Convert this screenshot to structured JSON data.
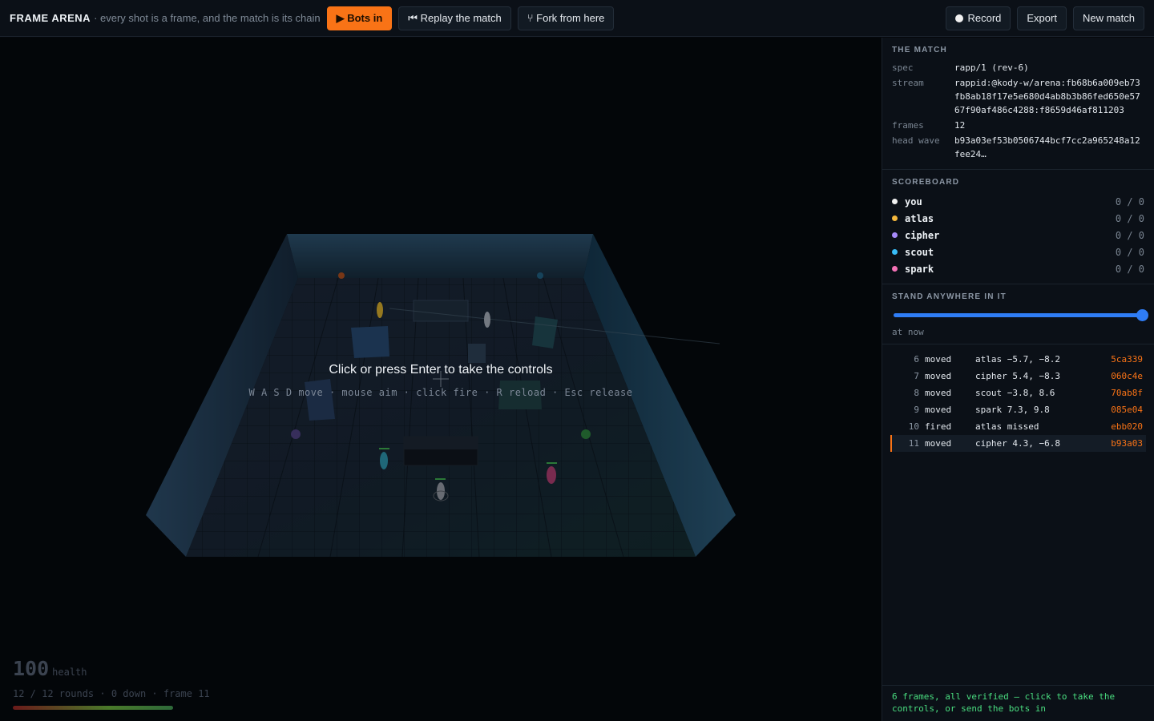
{
  "header": {
    "brand": "FRAME ARENA",
    "tagline": "· every shot is a frame, and the match is its chain",
    "bots_in": "▶ Bots in",
    "replay": "⏮ Replay the match",
    "fork": "⑂ Fork from here",
    "record": "Record",
    "export": "Export",
    "new_match": "New match"
  },
  "arena": {
    "prompt": "Click or press Enter to take the controls",
    "hint": "W A S D move · mouse aim · click fire · R reload · Esc release",
    "hud": {
      "health": "100",
      "health_label": "health",
      "meta": "12 / 12 rounds · 0 down · frame 11",
      "health_fraction": 1.0
    }
  },
  "match": {
    "title": "THE MATCH",
    "rows": [
      {
        "k": "spec",
        "v": "rapp/1 (rev-6)"
      },
      {
        "k": "stream",
        "v": "rappid:@kody-w/arena:fb68b6a009eb73fb8ab18f17e5e680d4ab8b3b86fed650e5767f90af486c4288:f8659d46af811203"
      },
      {
        "k": "frames",
        "v": "12"
      },
      {
        "k": "head wave",
        "v": "b93a03ef53b0506744bcf7cc2a965248a12fee24…"
      }
    ]
  },
  "scoreboard": {
    "title": "SCOREBOARD",
    "players": [
      {
        "name": "you",
        "score": "0 / 0",
        "color": "#f1f1f1"
      },
      {
        "name": "atlas",
        "score": "0 / 0",
        "color": "#f5b83d"
      },
      {
        "name": "cipher",
        "score": "0 / 0",
        "color": "#a78bfa"
      },
      {
        "name": "scout",
        "score": "0 / 0",
        "color": "#38bdf8"
      },
      {
        "name": "spark",
        "score": "0 / 0",
        "color": "#f472b6"
      }
    ]
  },
  "timeline": {
    "title": "STAND ANYWHERE IN IT",
    "caption": "at now",
    "position": 1.0
  },
  "events": [
    {
      "n": "6",
      "kind": "moved",
      "desc": "atlas −5.7, −8.2",
      "hash": "5ca339",
      "active": false
    },
    {
      "n": "7",
      "kind": "moved",
      "desc": "cipher 5.4, −8.3",
      "hash": "060c4e",
      "active": false
    },
    {
      "n": "8",
      "kind": "moved",
      "desc": "scout −3.8, 8.6",
      "hash": "70ab8f",
      "active": false
    },
    {
      "n": "9",
      "kind": "moved",
      "desc": "spark 7.3, 9.8",
      "hash": "085e04",
      "active": false
    },
    {
      "n": "10",
      "kind": "fired",
      "desc": "atlas missed",
      "hash": "ebb020",
      "active": false
    },
    {
      "n": "11",
      "kind": "moved",
      "desc": "cipher 4.3, −6.8",
      "hash": "b93a03",
      "active": true
    }
  ],
  "status": "6 frames, all verified — click to take the controls, or send the bots in",
  "colors": {
    "accent": "#f97316",
    "verified": "#4ade80",
    "slider": "#2f7df6"
  }
}
